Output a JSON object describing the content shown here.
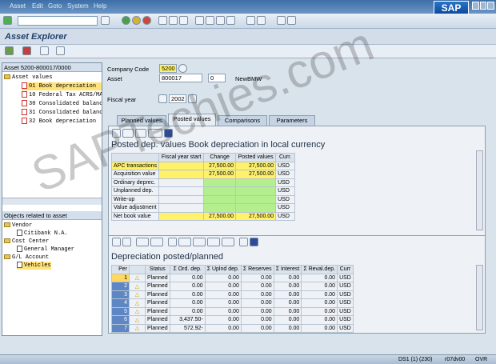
{
  "menu": {
    "items": [
      "Asset",
      "Edit",
      "Goto",
      "System",
      "Help"
    ],
    "logo": "SAP"
  },
  "title": "Asset Explorer",
  "tree": {
    "header": "Asset 5200-800017/0000",
    "items": [
      "Asset values",
      "01 Book depreciation",
      "10 Federal Tax ACRS/MACRS",
      "30 Consolidated balance",
      "31 Consolidated balance",
      "32 Book depreciation"
    ]
  },
  "related": {
    "header": "Objects related to asset",
    "items": [
      "Vendor",
      "Citibank N.A.",
      "Cost Center",
      "General Manager",
      "G/L Account",
      "Vehicles"
    ]
  },
  "fields": {
    "company_code_label": "Company Code",
    "company_code": "5200",
    "asset_label": "Asset",
    "asset": "800017",
    "sub": "0",
    "asset_desc": "NewBMW",
    "fiscal_year_label": "Fiscal year",
    "fiscal_year": "2002"
  },
  "tabs": [
    "Planned values",
    "Posted values",
    "Comparisons",
    "Parameters"
  ],
  "panel1": {
    "title": "Posted dep. values Book depreciation in local currency",
    "cols": [
      "Fiscal year start",
      "Change",
      "Posted values",
      "Curr."
    ],
    "rows": [
      {
        "label": "APC transactions",
        "start": "",
        "change": "27,500.00",
        "posted": "27,500.00",
        "curr": "USD"
      },
      {
        "label": "Acquisition value",
        "start": "",
        "change": "27,500.00",
        "posted": "27,500.00",
        "curr": "USD"
      },
      {
        "label": "Ordinary deprec.",
        "start": "",
        "change": "",
        "posted": "",
        "curr": "USD"
      },
      {
        "label": "Unplanned dep.",
        "start": "",
        "change": "",
        "posted": "",
        "curr": "USD"
      },
      {
        "label": "Write-up",
        "start": "",
        "change": "",
        "posted": "",
        "curr": "USD"
      },
      {
        "label": "Value adjustment",
        "start": "",
        "change": "",
        "posted": "",
        "curr": "USD"
      },
      {
        "label": "Net book value",
        "start": "",
        "change": "27,500.00",
        "posted": "27,500.00",
        "curr": "USD"
      }
    ]
  },
  "panel2": {
    "title": "Depreciation posted/planned",
    "cols": [
      "Per",
      "",
      "Status",
      "Σ Ord. dep.",
      "Σ Uplnd dep.",
      "Σ Reserves",
      "Σ Interest",
      "Σ Reval.dep.",
      "Curr"
    ],
    "rows": [
      {
        "per": "1",
        "status": "Planned",
        "ord": "0.00",
        "upl": "0.00",
        "res": "0.00",
        "int": "0.00",
        "rev": "0.00",
        "curr": "USD"
      },
      {
        "per": "2",
        "status": "Planned",
        "ord": "0.00",
        "upl": "0.00",
        "res": "0.00",
        "int": "0.00",
        "rev": "0.00",
        "curr": "USD"
      },
      {
        "per": "3",
        "status": "Planned",
        "ord": "0.00",
        "upl": "0.00",
        "res": "0.00",
        "int": "0.00",
        "rev": "0.00",
        "curr": "USD"
      },
      {
        "per": "4",
        "status": "Planned",
        "ord": "0.00",
        "upl": "0.00",
        "res": "0.00",
        "int": "0.00",
        "rev": "0.00",
        "curr": "USD"
      },
      {
        "per": "5",
        "status": "Planned",
        "ord": "0.00",
        "upl": "0.00",
        "res": "0.00",
        "int": "0.00",
        "rev": "0.00",
        "curr": "USD"
      },
      {
        "per": "6",
        "status": "Planned",
        "ord": "3,437.50-",
        "upl": "0.00",
        "res": "0.00",
        "int": "0.00",
        "rev": "0.00",
        "curr": "USD"
      },
      {
        "per": "7",
        "status": "Planned",
        "ord": "572.92-",
        "upl": "0.00",
        "res": "0.00",
        "int": "0.00",
        "rev": "0.00",
        "curr": "USD"
      }
    ]
  },
  "status": {
    "system": "DS1 (1) (230)",
    "server": "r07dv00",
    "mode": "OVR"
  },
  "watermark": "SAPTechies.com",
  "colors": {
    "yellow": "#fff16a",
    "green": "#b4ef8e",
    "title": "#21406b"
  }
}
